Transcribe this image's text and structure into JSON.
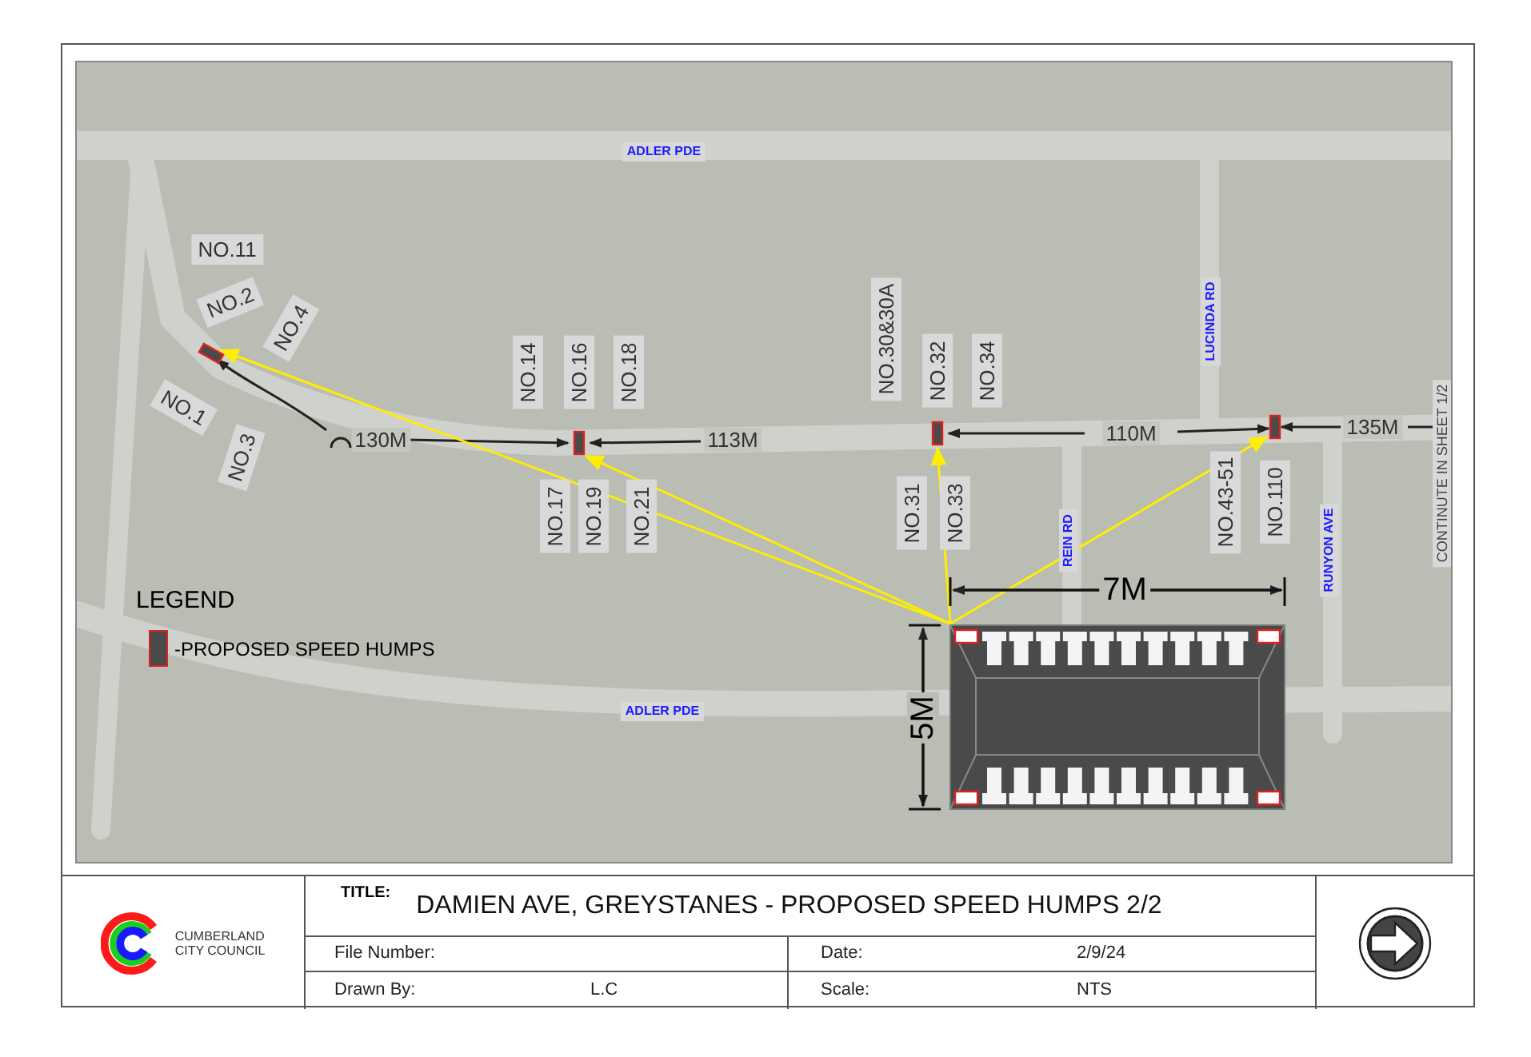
{
  "map": {
    "street_labels": [
      {
        "text": "ADLER PDE"
      },
      {
        "text": "LUCINDA RD"
      },
      {
        "text": "REIN RD"
      },
      {
        "text": "RUNYON AVE"
      },
      {
        "text": "ADLER PDE"
      }
    ],
    "house_labels": [
      {
        "text": "NO.11"
      },
      {
        "text": "NO.2"
      },
      {
        "text": "NO.4"
      },
      {
        "text": "NO.1"
      },
      {
        "text": "NO.3"
      },
      {
        "text": "NO.14"
      },
      {
        "text": "NO.16"
      },
      {
        "text": "NO.18"
      },
      {
        "text": "NO.17"
      },
      {
        "text": "NO.19"
      },
      {
        "text": "NO.21"
      },
      {
        "text": "NO.30&30A"
      },
      {
        "text": "NO.32"
      },
      {
        "text": "NO.34"
      },
      {
        "text": "NO.31"
      },
      {
        "text": "NO.33"
      },
      {
        "text": "NO.43-51"
      },
      {
        "text": "NO.110"
      }
    ],
    "distance_labels": [
      {
        "text": "130M"
      },
      {
        "text": "113M"
      },
      {
        "text": "110M"
      },
      {
        "text": "135M"
      }
    ],
    "note": "CONTINUTE IN SHEET 1/2",
    "legend": {
      "title": "LEGEND",
      "items": [
        {
          "label": "-PROPOSED SPEED HUMPS"
        }
      ]
    },
    "detail": {
      "width_label": "7M",
      "length_label": "5M"
    }
  },
  "title_block": {
    "org_name": [
      "CUMBERLAND",
      "CITY COUNCIL"
    ],
    "title_label": "TITLE:",
    "title": "DAMIEN AVE, GREYSTANES - PROPOSED SPEED HUMPS 2/2",
    "fields": [
      {
        "label": "File Number:"
      },
      {
        "label": "Date:",
        "value": "2/9/24"
      },
      {
        "label": "Drawn By:",
        "value": "L.C"
      },
      {
        "label": "Scale:",
        "value": "NTS"
      }
    ]
  }
}
